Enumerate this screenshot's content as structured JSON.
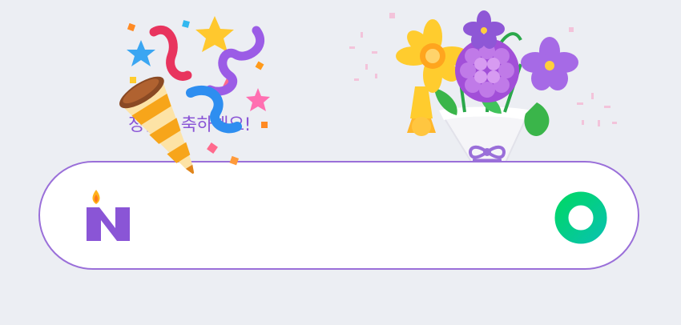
{
  "greeting": {
    "text": "정원을 축하해요!"
  },
  "search": {
    "value": "",
    "placeholder": ""
  },
  "colors": {
    "brand_purple": "#8a55d6",
    "search_border": "#9a6fd9",
    "search_button": "#03c75a",
    "background": "#eceef3"
  },
  "icons": {
    "logo": "naver-n-logo-icon",
    "search": "search-o-icon",
    "party": "party-popper-icon",
    "bouquet": "flower-bouquet-icon"
  }
}
